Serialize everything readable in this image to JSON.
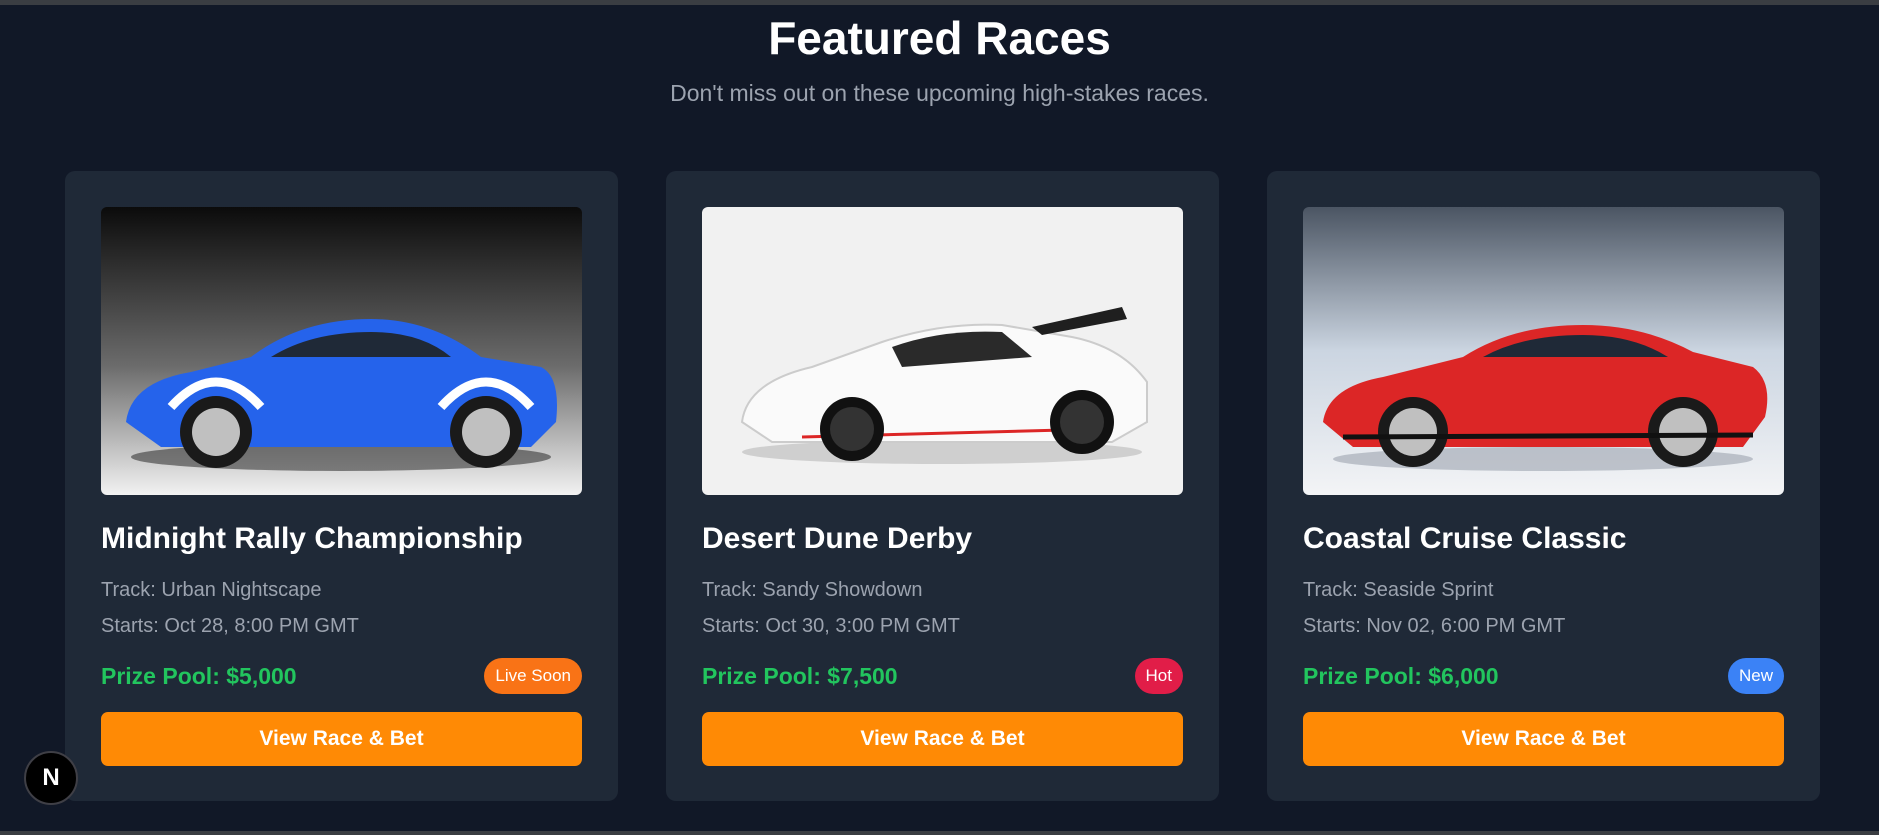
{
  "section": {
    "title": "Featured Races",
    "subtitle": "Don't miss out on these upcoming high-stakes races."
  },
  "cards": [
    {
      "name": "Midnight Rally Championship",
      "track": "Track: Urban Nightscape",
      "starts": "Starts: Oct 28, 8:00 PM GMT",
      "prize": "Prize Pool: $5,000",
      "badge": "Live Soon",
      "badge_color": "#f97316",
      "button": "View Race & Bet",
      "car_color": "#2563eb",
      "bg": "dark"
    },
    {
      "name": "Desert Dune Derby",
      "track": "Track: Sandy Showdown",
      "starts": "Starts: Oct 30, 3:00 PM GMT",
      "prize": "Prize Pool: $7,500",
      "badge": "Hot",
      "badge_color": "#e11d48",
      "button": "View Race & Bet",
      "car_color": "#f5f5f5",
      "bg": "light"
    },
    {
      "name": "Coastal Cruise Classic",
      "track": "Track: Seaside Sprint",
      "starts": "Starts: Nov 02, 6:00 PM GMT",
      "prize": "Prize Pool: $6,000",
      "badge": "New",
      "badge_color": "#3b82f6",
      "button": "View Race & Bet",
      "car_color": "#dc2626",
      "bg": "grey"
    }
  ],
  "dev_badge": {
    "letter": "N"
  },
  "colors": {
    "page_bg": "#111827",
    "card_bg": "#1f2937",
    "accent": "#ff8a05",
    "prize": "#22c55e",
    "muted": "#9ca3af"
  }
}
